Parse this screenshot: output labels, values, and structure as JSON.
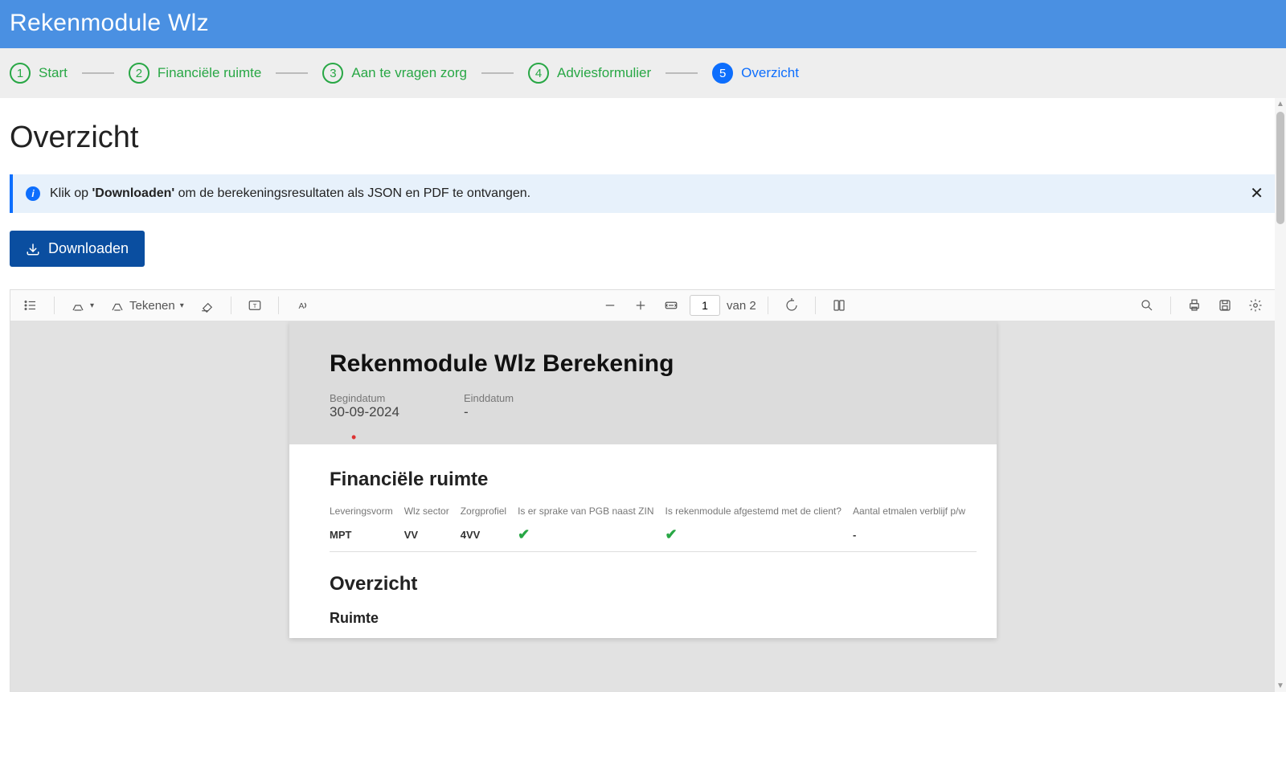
{
  "app": {
    "title": "Rekenmodule Wlz"
  },
  "steps": [
    {
      "num": "1",
      "label": "Start"
    },
    {
      "num": "2",
      "label": "Financiële ruimte"
    },
    {
      "num": "3",
      "label": "Aan te vragen zorg"
    },
    {
      "num": "4",
      "label": "Adviesformulier"
    },
    {
      "num": "5",
      "label": "Overzicht"
    }
  ],
  "page": {
    "heading": "Overzicht"
  },
  "banner": {
    "prefix": "Klik op ",
    "bold": "'Downloaden'",
    "suffix": " om de berekeningsresultaten als JSON en PDF te ontvangen."
  },
  "download": {
    "label": "Downloaden"
  },
  "viewer": {
    "draw_label": "Tekenen",
    "page_input": "1",
    "page_total_prefix": "van ",
    "page_total": "2"
  },
  "doc": {
    "title": "Rekenmodule Wlz Berekening",
    "begindatum_label": "Begindatum",
    "begindatum": "30-09-2024",
    "einddatum_label": "Einddatum",
    "einddatum": "-",
    "section1_heading": "Financiële ruimte",
    "table_headers": [
      "Leveringsvorm",
      "Wlz sector",
      "Zorgprofiel",
      "Is er sprake van PGB naast ZIN",
      "Is rekenmodule afgestemd met de client?",
      "Aantal etmalen verblijf p/w"
    ],
    "table_row": {
      "leveringsvorm": "MPT",
      "wlz_sector": "VV",
      "zorgprofiel": "4VV",
      "pgb_naast_zin": "check",
      "afgestemd": "check",
      "etmalen": "-"
    },
    "section2_heading": "Overzicht",
    "section2_sub": "Ruimte"
  }
}
